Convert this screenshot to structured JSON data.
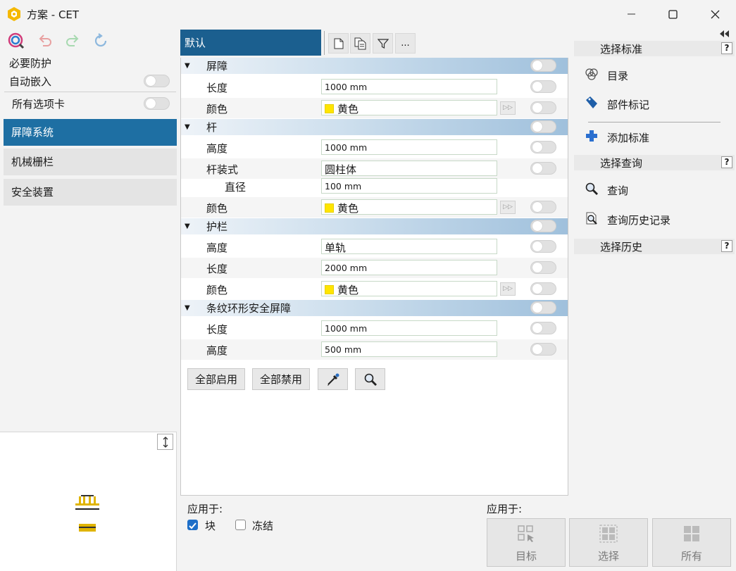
{
  "window": {
    "title": "方案 - CET"
  },
  "left": {
    "section_title": "必要防护",
    "auto_embed_label": "自动嵌入",
    "all_tabs_label": "所有选项卡",
    "nav": [
      "屏障系统",
      "机械栅栏",
      "安全装置"
    ]
  },
  "middle": {
    "tab_label": "默认",
    "groups": [
      {
        "title": "屏障",
        "rows": [
          {
            "label": "长度",
            "value": "1000 mm"
          },
          {
            "label": "颜色",
            "value": "黄色",
            "swatch": true
          }
        ]
      },
      {
        "title": "杆",
        "rows": [
          {
            "label": "高度",
            "value": "1000 mm"
          },
          {
            "label": "杆装式",
            "value": "圆柱体"
          },
          {
            "label": "直径",
            "value": "100 mm"
          },
          {
            "label": "颜色",
            "value": "黄色",
            "swatch": true
          }
        ]
      },
      {
        "title": "护栏",
        "rows": [
          {
            "label": "高度",
            "value": "单轨"
          },
          {
            "label": "长度",
            "value": "2000 mm"
          },
          {
            "label": "颜色",
            "value": "黄色",
            "swatch": true
          }
        ]
      },
      {
        "title": "条纹环形安全屏障",
        "rows": [
          {
            "label": "长度",
            "value": "1000 mm"
          },
          {
            "label": "高度",
            "value": "500 mm"
          }
        ]
      }
    ],
    "buttons": {
      "enable_all": "全部启用",
      "disable_all": "全部禁用"
    },
    "ellipsis": "..."
  },
  "right": {
    "sections": {
      "standard": "选择标准",
      "query": "选择查询",
      "history": "选择历史"
    },
    "help": "?",
    "items": {
      "catalog": "目录",
      "part_tag": "部件标记",
      "add_standard": "添加标准",
      "query": "查询",
      "query_history": "查询历史记录"
    }
  },
  "bottom": {
    "apply_to_left": "应用于:",
    "block_label": "块",
    "freeze_label": "冻结",
    "apply_to_right": "应用于:",
    "target": "目标",
    "select": "选择",
    "all": "所有"
  },
  "colors": {
    "accent": "#1e6fa3",
    "tab": "#1b5f8f",
    "yellow": "#ffe500"
  },
  "state": {
    "block_checked": true,
    "freeze_checked": false
  }
}
